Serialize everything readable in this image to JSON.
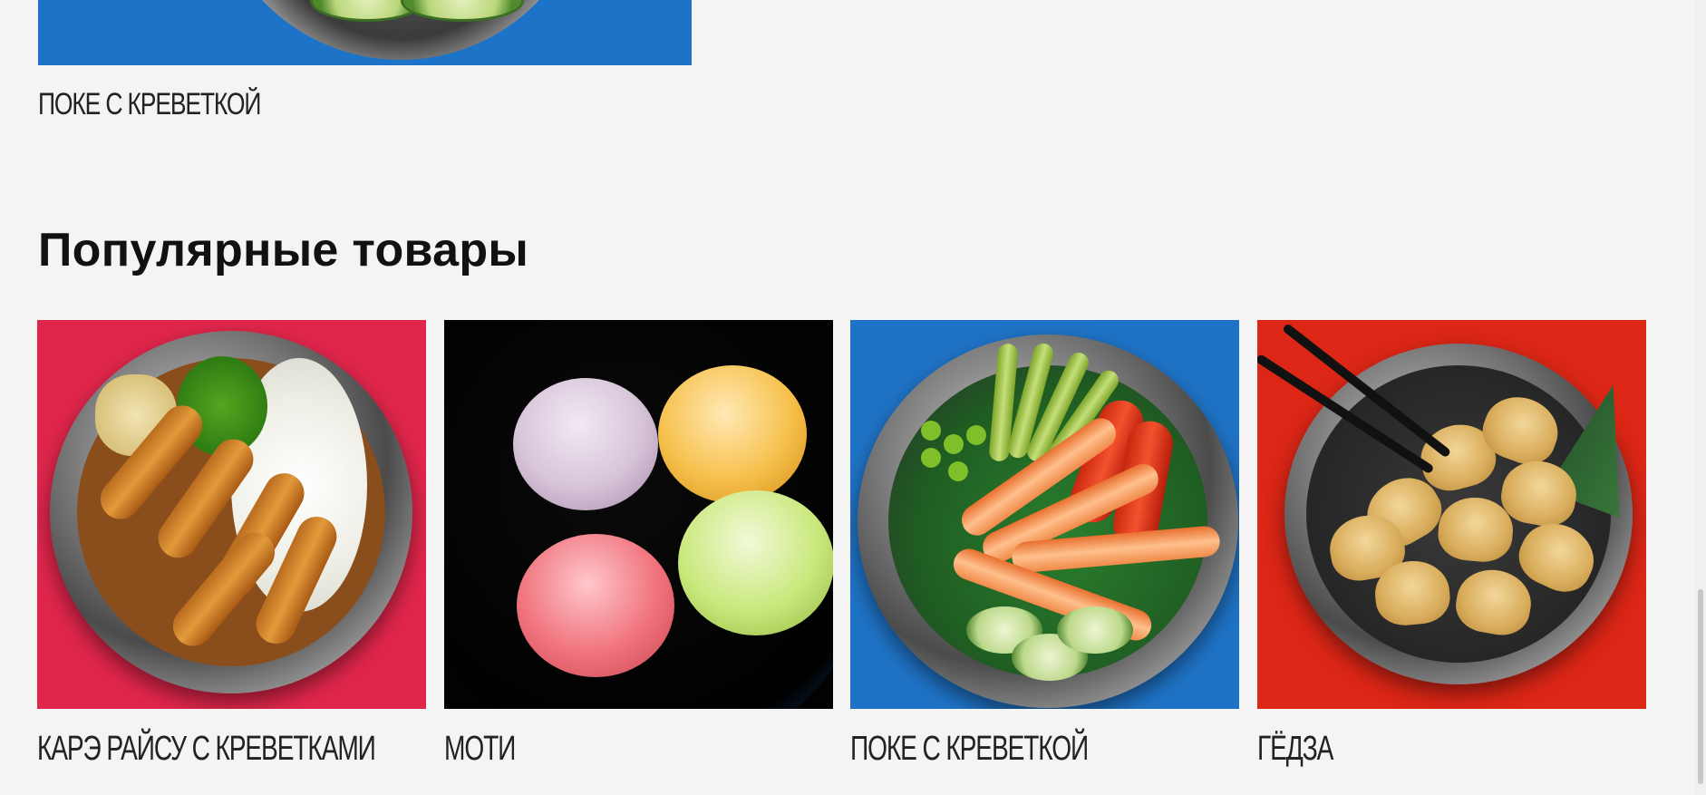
{
  "top_product": {
    "name": "ПОКЕ С КРЕВЕТКОЙ"
  },
  "section": {
    "title": "Популярные товары"
  },
  "products": [
    {
      "name": "КАРЭ РАЙСУ С КРЕВЕТКАМИ",
      "image": "curry-rice-shrimp"
    },
    {
      "name": "МОТИ",
      "image": "mochi"
    },
    {
      "name": "ПОКЕ С КРЕВЕТКОЙ",
      "image": "poke-shrimp"
    },
    {
      "name": "ГЁДЗА",
      "image": "gyoza"
    }
  ],
  "colors": {
    "background": "#f4f4f4",
    "curry_bg": "#e0264b",
    "mochi_bg": "#020202",
    "poke_bg": "#1f73c6",
    "gyoza_bg": "#dc2616"
  }
}
